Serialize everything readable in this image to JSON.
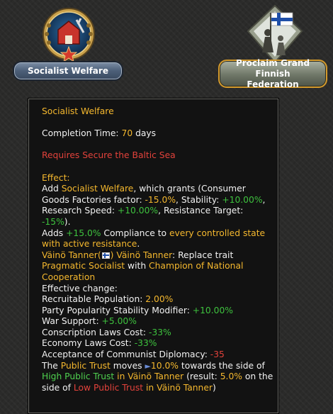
{
  "focuses": [
    {
      "label": "Socialist Welfare",
      "icon": "socialist-welfare-icon"
    },
    {
      "label_lines": [
        "Proclaim Grand Finnish",
        "Federation"
      ],
      "icon": "finnish-flag-icon"
    }
  ],
  "tooltip": {
    "title": "Socialist Welfare",
    "completion_label": "Completion Time: ",
    "completion_value": "70",
    "completion_unit": " days",
    "requires": "Requires Secure the Baltic Sea",
    "effect_label": "Effect:",
    "l1_a": "Add ",
    "l1_b": "Socialist Welfare",
    "l1_c": ", which grants (Consumer",
    "l2_a": "Goods Factories factor: ",
    "l2_b": "-15.0%",
    "l2_c": ", Stability: ",
    "l2_d": "+10.00%",
    "l2_e": ",",
    "l3_a": "Research Speed: ",
    "l3_b": "+10.00%",
    "l3_c": ", Resistance Target:",
    "l4_a": "-15%",
    "l4_b": ").",
    "l5_a": "Adds ",
    "l5_b": "+15.0%",
    "l5_c": " Compliance to ",
    "l5_d": " every controlled state",
    "l6": "with active resistance",
    "l6_end": ".",
    "l7_a": "Väinö Tanner(",
    "l7_b": ") Väinö Tanner",
    "l7_c": ": Replace trait",
    "l8_a": "Pragmatic Socialist",
    "l8_b": " with ",
    "l8_c": "Champion of National",
    "l9": "Cooperation",
    "l10": "Effective change:",
    "l11_a": "Recruitable Population: ",
    "l11_b": "2.00%",
    "l12_a": "Party Popularity Stability Modifier: ",
    "l12_b": "+10.00%",
    "l13_a": "War Support: ",
    "l13_b": "+5.00%",
    "l14_a": "Conscription Laws Cost: ",
    "l14_b": "-33%",
    "l15_a": "Economy Laws Cost: ",
    "l15_b": "-33%",
    "l16_a": "Acceptance of Communist Diplomacy: ",
    "l16_b": "-35",
    "l17_a": "The ",
    "l17_b": "Public Trust",
    "l17_c": " moves ",
    "l17_d": "10.0%",
    "l17_e": " towards the side of",
    "l18_a": "High Public Trust",
    "l18_b": " in Väinö Tanner",
    "l18_c": " (result: ",
    "l18_d": "5.0%",
    "l18_e": " on the",
    "l19_a": "side of ",
    "l19_b": "Low Public Trust",
    "l19_c": " in Väinö Tanner",
    "l19_d": ")"
  },
  "colors": {
    "highlight": "#f5b82e",
    "positive": "#3ec23e",
    "negative": "#e3423b"
  }
}
